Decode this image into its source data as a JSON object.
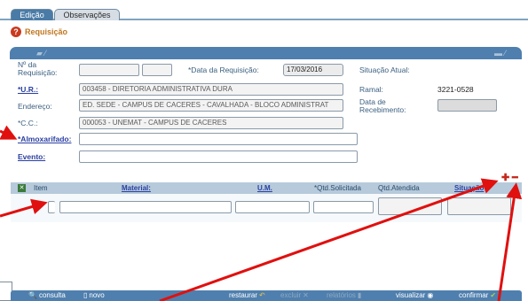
{
  "tabs": [
    {
      "label": "Edição",
      "active": true
    },
    {
      "label": "Observações",
      "active": false
    }
  ],
  "section_title": "Requisição",
  "form": {
    "numero_label": "Nº da Requisição:",
    "data_label": "*Data da Requisição:",
    "data_value": "17/03/2016",
    "situacao_label": "Situação Atual:",
    "ur_label": "*U.R.:",
    "ur_value": "003458 - DIRETORIA ADMINISTRATIVA DURA",
    "ramal_label": "Ramal:",
    "ramal_value": "3221-0528",
    "endereco_label": "Endereço:",
    "endereco_value": "ED. SEDE - CAMPUS DE CACERES - CAVALHADA - BLOCO ADMINISTRAT",
    "data_receb_label": "Data de Recebimento:",
    "cc_label": "*C.C.:",
    "cc_value": "000053 - UNEMAT - CAMPUS DE CACERES",
    "almox_label": "*Almoxarifado:",
    "evento_label": "Evento:"
  },
  "grid": {
    "headers": {
      "item": "Item",
      "material": "Material:",
      "um": "U.M.",
      "qtd_solicitada": "*Qtd.Solicitada",
      "qtd_atendida": "Qtd.Atendida",
      "situacao": "Situação"
    },
    "plus": "✚",
    "minus": "━"
  },
  "toolbar": {
    "consulta": "consulta",
    "novo": "novo",
    "restaurar": "restaurar",
    "excluir": "excluir",
    "relatorios": "relatórios",
    "visualizar": "visualizar",
    "confirmar": "confirmar"
  },
  "colors": {
    "accent": "#4f7fae",
    "arrow": "#e0100f"
  }
}
